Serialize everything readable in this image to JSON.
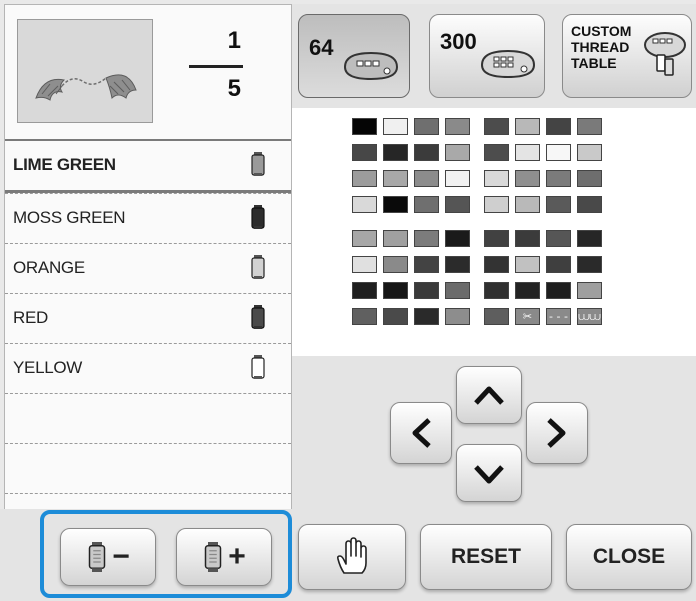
{
  "colors": {
    "selection_frame": "#1d8cd8",
    "panel_bg": "#fafafa",
    "button_text": "#222222"
  },
  "preview": {
    "current": "1",
    "total": "5",
    "icon": "embroidery-pattern-preview"
  },
  "threads": [
    {
      "name": "LIME GREEN",
      "spool": "spool-light",
      "selected": true
    },
    {
      "name": "MOSS GREEN",
      "spool": "spool-dark",
      "selected": false
    },
    {
      "name": "ORANGE",
      "spool": "spool-light",
      "selected": false
    },
    {
      "name": "RED",
      "spool": "spool-dark",
      "selected": false
    },
    {
      "name": "YELLOW",
      "spool": "spool-empty",
      "selected": false
    }
  ],
  "tabs": {
    "tab64": {
      "label": "64",
      "icon": "thread-cassette-icon"
    },
    "tab300": {
      "label": "300",
      "icon": "thread-cassette-icon"
    },
    "custom": {
      "label_line1": "CUSTOM",
      "label_line2": "THREAD",
      "label_line3": "TABLE",
      "icon": "custom-thread-table-icon"
    }
  },
  "palette": {
    "rows": [
      [
        "#050505",
        "#f0f0f0",
        "#6f6f6f",
        "#8a8a8a",
        "#4c4c4c",
        "#b8b8b8",
        "#444444",
        "#7a7a7a"
      ],
      [
        "#474747",
        "#262626",
        "#3b3b3b",
        "#a9a9a9",
        "#4d4d4d",
        "#e4e4e4",
        "#f7f7f7",
        "#c9c9c9"
      ],
      [
        "#9c9c9c",
        "#a8a8a8",
        "#8c8c8c",
        "#f2f2f2",
        "#d9d9d9",
        "#8f8f8f",
        "#7b7b7b",
        "#6e6e6e"
      ],
      [
        "#d9d9d9",
        "#0a0a0a",
        "#6f6f6f",
        "#555555",
        "#cfcfcf",
        "#b9b9b9",
        "#5a5a5a",
        "#494949"
      ],
      [
        "#a7a7a7",
        "#a0a0a0",
        "#7c7c7c",
        "#1a1a1a",
        "#414141",
        "#3b3b3b",
        "#565656",
        "#262626"
      ],
      [
        "#e0e0e0",
        "#8a8a8a",
        "#434343",
        "#2b2b2b",
        "#333333",
        "#c1c1c1",
        "#3f3f3f",
        "#2a2a2a"
      ],
      [
        "#1f1f1f",
        "#161616",
        "#3a3a3a",
        "#6b6b6b",
        "#303030",
        "#232323",
        "#1e1e1e",
        "#9f9f9f"
      ],
      [
        "#606060",
        "#4a4a4a",
        "#2a2a2a",
        "#8d8d8d",
        "#5e5e5e",
        "special-cut",
        "special-gap",
        "special-stitch"
      ]
    ],
    "special_cells": [
      "scissors-icon",
      "dashed-line-icon",
      "stitch-icon"
    ]
  },
  "nav": {
    "up": "chevron-up-icon",
    "down": "chevron-down-icon",
    "left": "chevron-left-icon",
    "right": "chevron-right-icon"
  },
  "footer": {
    "remove_spool": "−",
    "add_spool": "+",
    "hand_icon": "hand-icon",
    "reset_label": "RESET",
    "close_label": "CLOSE"
  }
}
